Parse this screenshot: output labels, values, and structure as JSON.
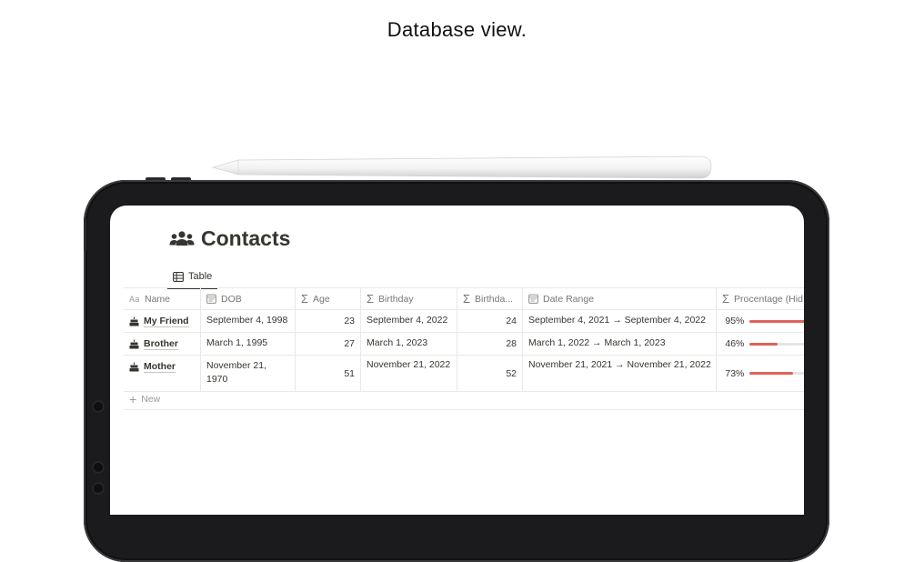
{
  "caption": "Database view.",
  "page": {
    "icon": "people-group-icon",
    "title": "Contacts"
  },
  "view_tab": {
    "icon": "table-icon",
    "label": "Table"
  },
  "table": {
    "columns": [
      {
        "key": "name",
        "label": "Name",
        "icon": "text-aa-icon"
      },
      {
        "key": "dob",
        "label": "DOB",
        "icon": "calendar-icon"
      },
      {
        "key": "age",
        "label": "Age",
        "icon": "sigma-icon"
      },
      {
        "key": "birthday",
        "label": "Birthday",
        "icon": "sigma-icon"
      },
      {
        "key": "birthday_age",
        "label": "Birthda...",
        "icon": "sigma-icon"
      },
      {
        "key": "date_range",
        "label": "Date Range",
        "icon": "calendar-icon"
      },
      {
        "key": "percentage",
        "label": "Procentage (Hid",
        "icon": "sigma-icon"
      }
    ],
    "rows": [
      {
        "name": "My Friend",
        "dob": "September 4, 1998",
        "age": "23",
        "birthday": "September 4, 2022",
        "birthday_age": "24",
        "date_range": "September 4, 2021 → September 4, 2022",
        "percentage": "95%",
        "progress": 0.95
      },
      {
        "name": "Brother",
        "dob": "March 1, 1995",
        "age": "27",
        "birthday": "March 1, 2023",
        "birthday_age": "28",
        "date_range": "March 1, 2022 → March 1, 2023",
        "percentage": "46%",
        "progress": 0.46
      },
      {
        "name": "Mother",
        "dob": "November 21, 1970",
        "age": "51",
        "birthday": "November 21, 2022",
        "birthday_age": "52",
        "date_range": "November 21, 2021 → November 21, 2022",
        "percentage": "73%",
        "progress": 0.73
      }
    ],
    "new_label": "New",
    "row_icon": "birthday-cake-icon"
  },
  "colors": {
    "progress_fill": "#e16259",
    "progress_track": "#e6e5e3",
    "text": "#37352f",
    "muted": "#787774"
  }
}
